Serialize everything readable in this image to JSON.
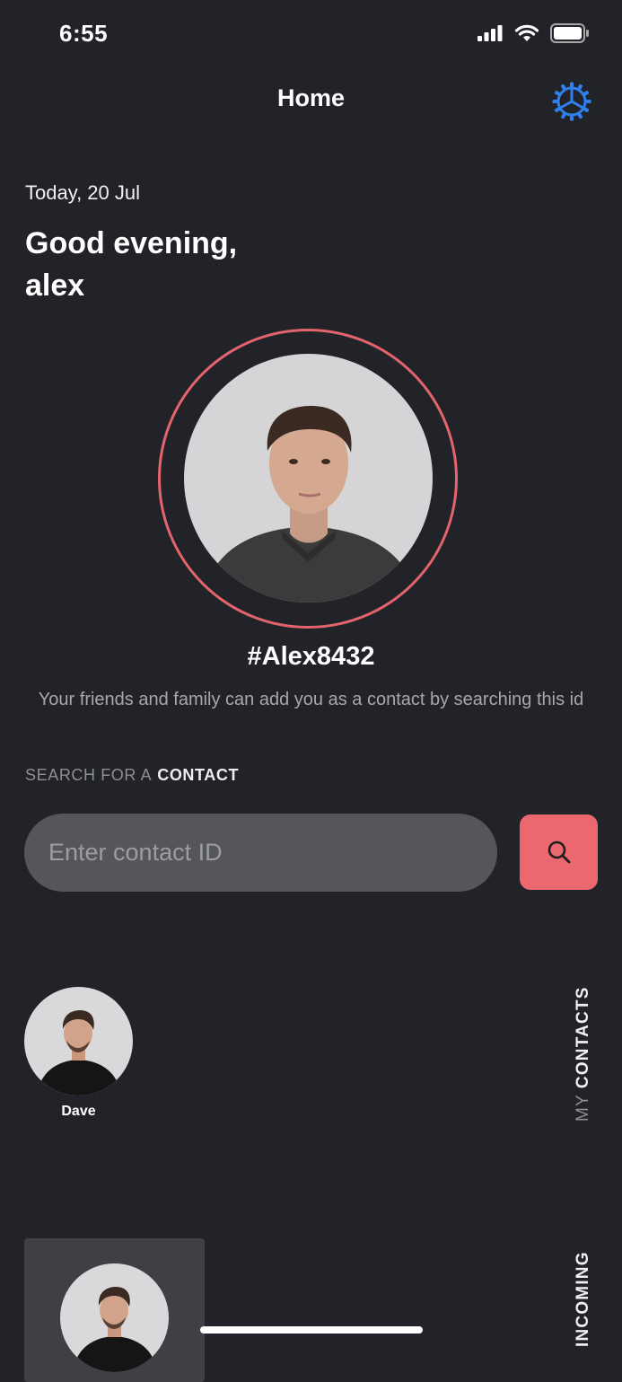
{
  "status_bar": {
    "time": "6:55",
    "icons": [
      "cellular-signal-icon",
      "wifi-icon",
      "battery-icon"
    ]
  },
  "header": {
    "title": "Home",
    "settings_icon": "settings-gear-icon"
  },
  "greeting": {
    "date": "Today, 20 Jul",
    "line1": "Good evening,",
    "line2": "alex"
  },
  "profile": {
    "user_id": "#Alex8432",
    "hint": "Your friends and family can add you as a contact by searching this id"
  },
  "search": {
    "heading_muted": "SEARCH FOR A",
    "heading_strong": "CONTACT",
    "placeholder": "Enter contact ID",
    "button_icon": "search-icon"
  },
  "contacts": {
    "section_muted": "MY",
    "section_strong": "CONTACTS",
    "items": [
      {
        "name": "Dave"
      }
    ]
  },
  "incoming": {
    "section_label": "INCOMING"
  },
  "colors": {
    "background": "#212329",
    "accent": "#ec6870",
    "settings_icon": "#2f80ed",
    "input_bg": "#54565b"
  }
}
